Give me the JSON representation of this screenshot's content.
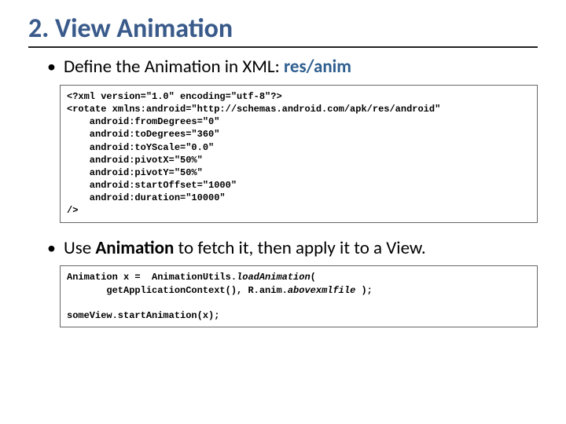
{
  "title": "2. View Animation",
  "bullets": {
    "b1_prefix": "Define the Animation in XML: ",
    "b1_path": "res/anim",
    "b2_prefix": "Use ",
    "b2_bold": "Animation",
    "b2_suffix": " to fetch it, then apply it to a View."
  },
  "code1": {
    "l1": "<?xml version=\"1.0\" encoding=\"utf-8\"?>",
    "l2": "<rotate xmlns:android=\"http://schemas.android.com/apk/res/android\"",
    "l3": "    android:fromDegrees=\"0\"",
    "l4": "    android:toDegrees=\"360\"",
    "l5": "    android:toYScale=\"0.0\"",
    "l6": "    android:pivotX=\"50%\"",
    "l7": "    android:pivotY=\"50%\"",
    "l8": "    android:startOffset=\"1000\"",
    "l9": "    android:duration=\"10000\"",
    "l10": "/>"
  },
  "code2": {
    "l1a": "Animation x =  AnimationUtils.",
    "l1b": "loadAnimation",
    "l1c": "(",
    "l2a": "       getApplicationContext(), R.anim.",
    "l2b": "abovexmlfile",
    "l2c": " );",
    "blank": " ",
    "l3": "someView.startAnimation(x);"
  }
}
